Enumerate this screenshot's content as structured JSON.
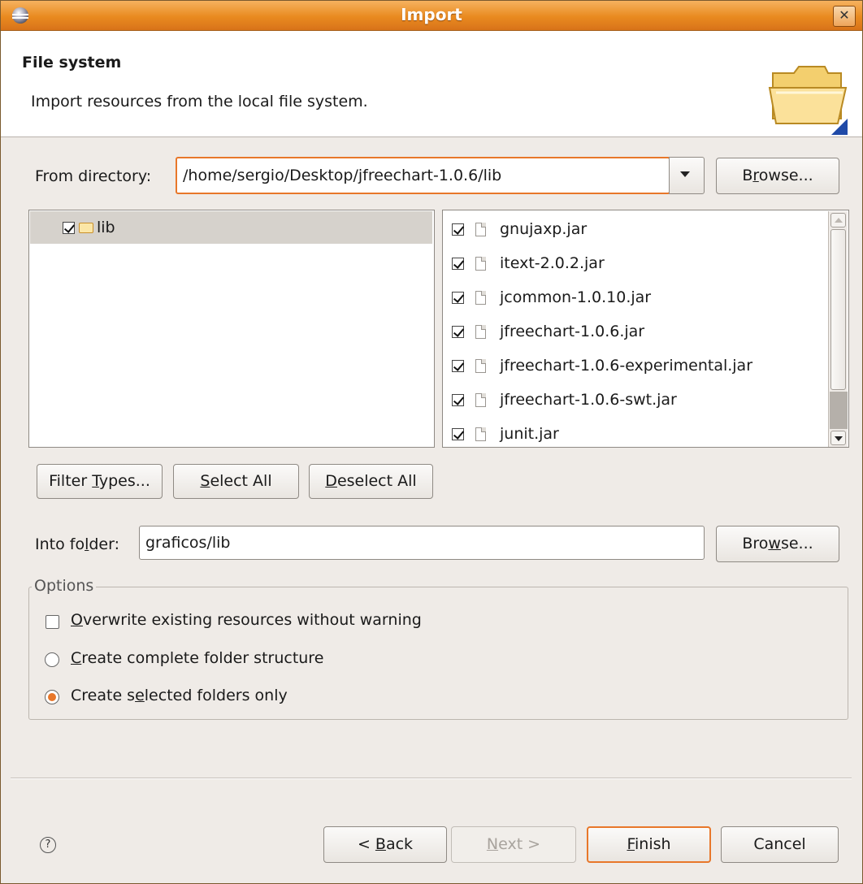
{
  "window": {
    "title": "Import"
  },
  "header": {
    "title": "File system",
    "description": "Import resources from the local file system."
  },
  "source": {
    "label": "From directory:",
    "path": "/home/sergio/Desktop/jfreechart-1.0.6/lib",
    "browse_label": "Browse...",
    "browse_mnemonic": "r"
  },
  "tree": [
    {
      "label": "lib",
      "checked": true,
      "selected": true
    }
  ],
  "files": [
    {
      "name": "gnujaxp.jar",
      "checked": true
    },
    {
      "name": "itext-2.0.2.jar",
      "checked": true
    },
    {
      "name": "jcommon-1.0.10.jar",
      "checked": true
    },
    {
      "name": "jfreechart-1.0.6.jar",
      "checked": true
    },
    {
      "name": "jfreechart-1.0.6-experimental.jar",
      "checked": true
    },
    {
      "name": "jfreechart-1.0.6-swt.jar",
      "checked": true
    },
    {
      "name": "junit.jar",
      "checked": true
    }
  ],
  "selection_buttons": {
    "filter_types": "Filter Types...",
    "select_all": "Select All",
    "deselect_all": "Deselect All"
  },
  "destination": {
    "label": "Into folder:",
    "value": "graficos/lib",
    "browse_label": "Browse..."
  },
  "options": {
    "group_label": "Options",
    "overwrite": {
      "label": "Overwrite existing resources without warning",
      "checked": false
    },
    "create_complete": {
      "label": "Create complete folder structure",
      "selected": false
    },
    "create_selected": {
      "label": "Create selected folders only",
      "selected": true
    }
  },
  "footer": {
    "help_icon": "?",
    "back": "< Back",
    "next": "Next >",
    "finish": "Finish",
    "cancel": "Cancel"
  }
}
